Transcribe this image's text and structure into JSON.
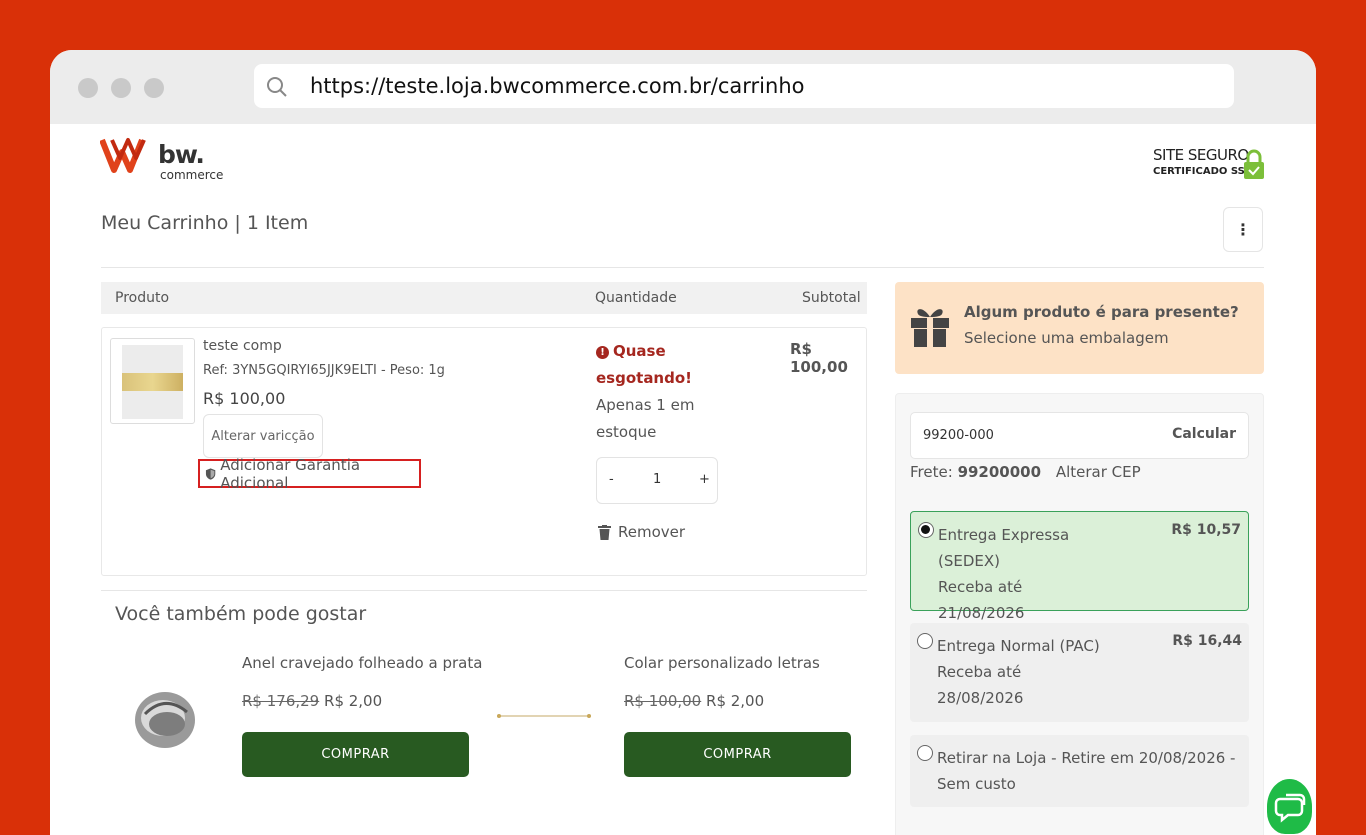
{
  "browser": {
    "url": "https://teste.loja.bwcommerce.com.br/carrinho"
  },
  "brand": {
    "logo_text": "bw.",
    "logo_sub": "commerce",
    "ssl_line1": "SITE SEGURO",
    "ssl_line2": "CERTIFICADO SSL"
  },
  "cart": {
    "title": "Meu Carrinho | 1 Item",
    "menu_icon": "⋮",
    "columns": {
      "product": "Produto",
      "quantity": "Quantidade",
      "subtotal": "Subtotal"
    },
    "item": {
      "name": "teste comp",
      "ref": "Ref: 3YN5GQIRYI65JJK9ELTI - Peso: 1g",
      "price": "R$ 100,00",
      "change_variation": "Alterar varicção",
      "warranty": "Adicionar Garantia Adicional",
      "stock_warning": "Quase esgotando!",
      "stock_available": "Apenas 1 em estoque",
      "qty_minus": "-",
      "qty_value": "1",
      "qty_plus": "+",
      "remove": "Remover",
      "subtotal": "R$ 100,00"
    }
  },
  "recommendations": {
    "title": "Você também pode gostar",
    "items": [
      {
        "name": "Anel cravejado folheado a prata",
        "old_price": "R$ 176,29",
        "price": "R$ 2,00",
        "button": "COMPRAR"
      },
      {
        "name": "Colar personalizado letras",
        "old_price": "R$ 100,00",
        "price": "R$ 2,00",
        "button": "COMPRAR"
      }
    ]
  },
  "gift": {
    "title": "Algum produto é para presente?",
    "subtitle": "Selecione uma embalagem"
  },
  "shipping": {
    "cep_value": "99200-000",
    "calc_button": "Calcular",
    "frete_label": "Frete:",
    "frete_cep": "99200000",
    "change_cep": "Alterar CEP",
    "options": [
      {
        "name": "Entrega Expressa (SEDEX)",
        "eta": "Receba até 21/08/2026",
        "price": "R$ 10,57",
        "selected": true
      },
      {
        "name": "Entrega Normal (PAC)",
        "eta": "Receba até 28/08/2026",
        "price": "R$ 16,44",
        "selected": false
      },
      {
        "name": "Retirar na Loja - Retire em 20/08/2026 - Sem custo",
        "eta": "",
        "price": "",
        "selected": false
      }
    ]
  },
  "colors": {
    "background": "#d93008",
    "buy_button": "#285a21",
    "gift_bg": "#fde2c6",
    "selected_bg": "#dbf0d8",
    "warning": "#a5271f"
  }
}
